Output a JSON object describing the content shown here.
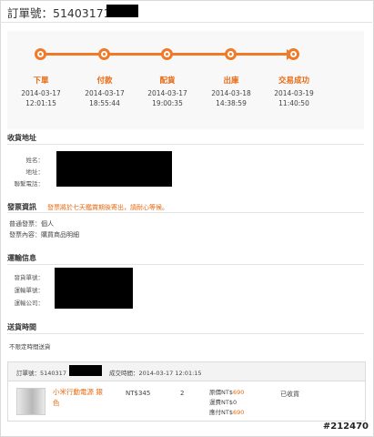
{
  "header": {
    "order_label": "訂單號：514031718"
  },
  "progress": {
    "steps": [
      {
        "label": "下單",
        "date": "2014-03-17",
        "time": "12:01:15"
      },
      {
        "label": "付款",
        "date": "2014-03-17",
        "time": "18:55:44"
      },
      {
        "label": "配貨",
        "date": "2014-03-17",
        "time": "19:00:35"
      },
      {
        "label": "出庫",
        "date": "2014-03-18",
        "time": "14:38:59"
      },
      {
        "label": "交易成功",
        "date": "2014-03-19",
        "time": "11:40:50"
      }
    ]
  },
  "shipping_address": {
    "title": "收貨地址",
    "fields": {
      "name": "姓名：",
      "address": "地址：",
      "phone": "聯繫電話："
    }
  },
  "invoice": {
    "title": "發票資訊",
    "notice": "發票將於七天鑑賞期後寄出，請耐心等候。",
    "type": "普通發票：個人",
    "content": "發票內容：購買商品明細"
  },
  "logistics": {
    "title": "運輸信息",
    "fields": {
      "shipping_no": "發貨單號：",
      "tracking_no": "運輸單號：",
      "carrier": "運輸公司："
    }
  },
  "delivery": {
    "title": "送貨時間",
    "value": "不限定時間送貨"
  },
  "order_table": {
    "order_label": "訂單號：5140317",
    "deal_time": "成交時間：2014-03-17 12:01:15",
    "item": {
      "name_line1": "小米行動電源 銀",
      "name_line2": "色",
      "price": "NT$345",
      "qty": "2",
      "original_label": "原價NT$",
      "original_value": "690",
      "shipping": "運費NT$0",
      "paid_label": "應付NT$",
      "paid_value": "690",
      "status": "已收貨"
    }
  },
  "watermark": "#212470",
  "colors": {
    "accent": "#f07a28",
    "accent_text": "#e86a12",
    "redaction": "#000000"
  }
}
